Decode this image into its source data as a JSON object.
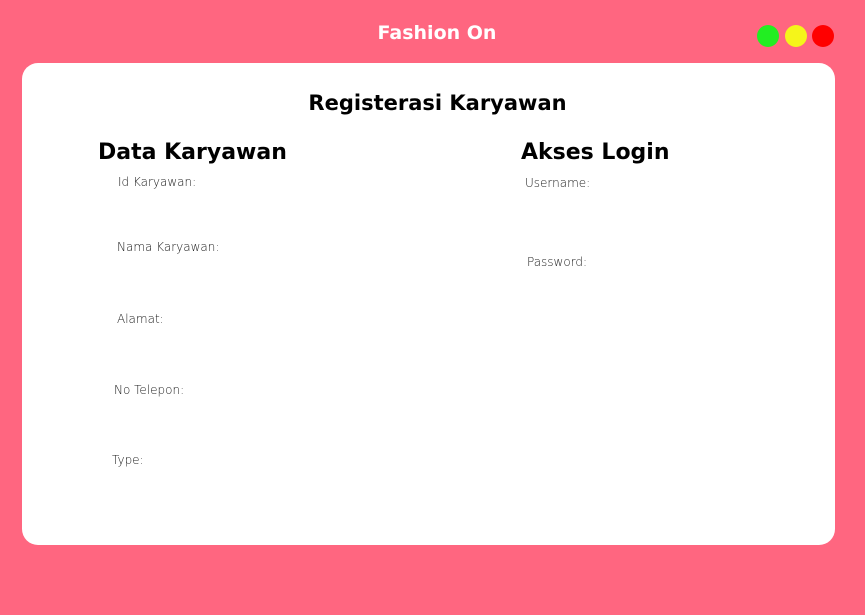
{
  "window": {
    "title": "Fashion On",
    "controls": [
      {
        "name": "maximize",
        "color": "#22ee22"
      },
      {
        "name": "minimize",
        "color": "#f5f51a"
      },
      {
        "name": "close",
        "color": "#ff0000"
      }
    ]
  },
  "colors": {
    "background": "#ff6680",
    "card": "#ffffff"
  },
  "form": {
    "title": "Registerasi Karyawan",
    "data_karyawan": {
      "heading": "Data Karyawan",
      "fields": [
        {
          "label": "Id Karyawan:"
        },
        {
          "label": "Nama Karyawan:"
        },
        {
          "label": "Alamat:"
        },
        {
          "label": "No Telepon:"
        },
        {
          "label": "Type:"
        }
      ]
    },
    "akses_login": {
      "heading": "Akses Login",
      "fields": [
        {
          "label": "Username:"
        },
        {
          "label": "Password:"
        }
      ]
    }
  }
}
